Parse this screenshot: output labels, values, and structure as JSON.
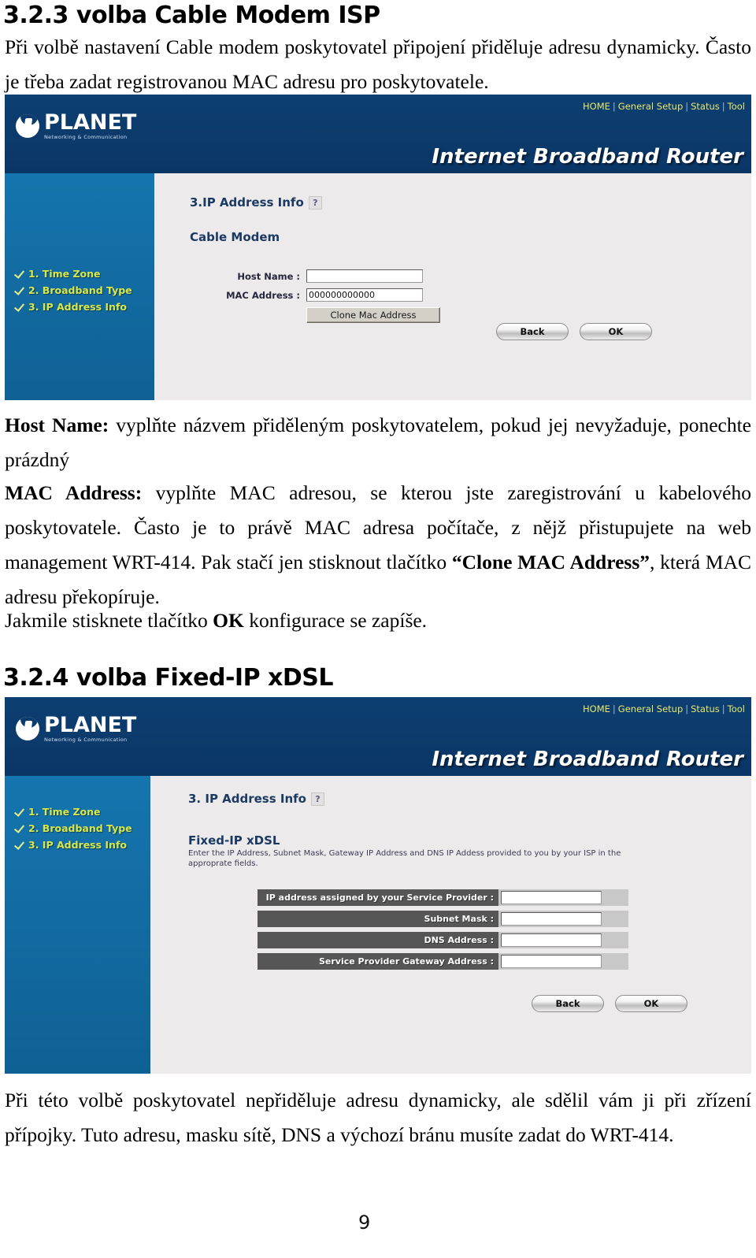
{
  "page": {
    "number": "9"
  },
  "sections": [
    {
      "id": "s323",
      "number": "3.2.3",
      "title": "volba Cable Modem ISP",
      "intro": "Při volbě nastavení Cable modem poskytovatel připojení přiděluje adresu dynamicky. Často je třeba zadat registrovanou MAC adresu pro poskytovatele."
    },
    {
      "id": "s324",
      "number": "3.2.4",
      "title": "volba Fixed-IP xDSL"
    }
  ],
  "body": {
    "p1_lead": "Host Name:",
    "p1_text": " vyplňte názvem přiděleným poskytovatelem, pokud jej nevyžaduje, ponechte prázdný",
    "p2_lead": "MAC Address:",
    "p2_text": " vyplňte MAC adresou, se kterou jste zaregistrování u kabelového poskytovatele. Často je to právě MAC adresa počítače, z nějž přistupujete na web management WRT-414. Pak stačí jen stisknout tlačítko ",
    "p2_bold2": "“Clone MAC Address”",
    "p2_text2": ", která MAC adresu překopíruje.",
    "p3_text": "Jakmile stisknete tlačítko ",
    "p3_bold": "OK",
    "p3_text2": " konfigurace se zapíše.",
    "p4_text": "Při této volbě poskytovatel nepřiděluje adresu dynamicky, ale sdělil vám ji při zřízení přípojky. Tuto adresu, masku sítě, DNS a výchozí bránu musíte zadat do WRT-414."
  },
  "router_ui": {
    "logo_word": "PLANET",
    "logo_tagline": "Networking & Communication",
    "topnav": [
      "HOME",
      "General Setup",
      "Status",
      "Tool"
    ],
    "topnav_separator": "|",
    "brand_title": "Internet Broadband Router",
    "sidebar_items": [
      {
        "label": "1. Time Zone"
      },
      {
        "label": "2. Broadband Type"
      },
      {
        "label": "3. IP Address Info"
      }
    ],
    "help_glyph": "?",
    "buttons": {
      "back": "Back",
      "ok": "OK"
    },
    "cable_modem": {
      "section_title": "3.IP Address Info",
      "block_title": "Cable Modem",
      "fields": [
        {
          "label": "Host Name :",
          "value": ""
        },
        {
          "label": "MAC Address :",
          "value": "000000000000"
        }
      ],
      "clone_button": "Clone Mac Address"
    },
    "fixed_ip": {
      "section_title": "3. IP Address Info",
      "block_title": "Fixed-IP xDSL",
      "block_desc": "Enter the IP Address, Subnet Mask, Gateway IP Address and DNS IP Addess provided to you by your ISP in the approprate fields.",
      "fields": [
        {
          "label": "IP address assigned by your Service Provider :",
          "value": ""
        },
        {
          "label": "Subnet Mask :",
          "value": ""
        },
        {
          "label": "DNS Address :",
          "value": ""
        },
        {
          "label": "Service Provider Gateway Address :",
          "value": ""
        }
      ]
    }
  },
  "colors": {
    "header_navy": "#0c3c6e",
    "sidebar_blue": "#1473ac",
    "content_gray": "#eceaea",
    "menu_yellow": "#d8e84a",
    "label_dark": "#565656",
    "title_navy": "#1b3a63"
  }
}
